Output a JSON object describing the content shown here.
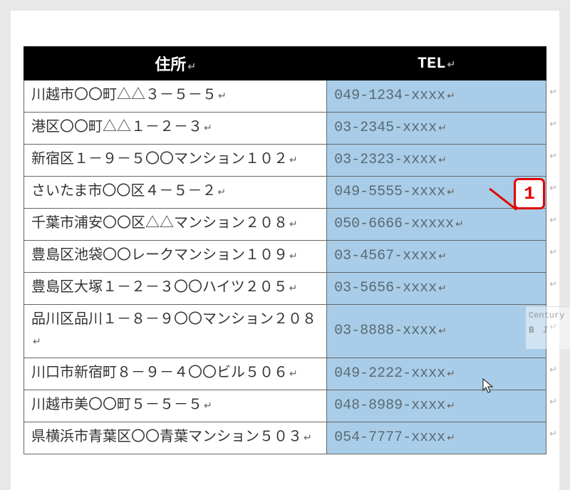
{
  "table": {
    "headers": {
      "address": "住所",
      "tel": "TEL"
    },
    "rows": [
      {
        "address": "川越市〇〇町△△３－５－５",
        "tel": "049-1234-xxxx"
      },
      {
        "address": "港区〇〇町△△１－２－３",
        "tel": "03-2345-xxxx"
      },
      {
        "address": "新宿区１－９－５〇〇マンション１０２",
        "tel": "03-2323-xxxx"
      },
      {
        "address": "さいたま市〇〇区４－５－２",
        "tel": "049-5555-xxxx"
      },
      {
        "address": "千葉市浦安〇〇区△△マンション２０８",
        "tel": "050-6666-xxxxx"
      },
      {
        "address": "豊島区池袋〇〇レークマンション１０９",
        "tel": "03-4567-xxxx"
      },
      {
        "address": "豊島区大塚１－２－３〇〇ハイツ２０５",
        "tel": "03-5656-xxxx"
      },
      {
        "address": "品川区品川１－８－９〇〇マンション２０８",
        "tel": "03-8888-xxxx"
      },
      {
        "address": "川口市新宿町８－９－４〇〇ビル５０６",
        "tel": "049-2222-xxxx"
      },
      {
        "address": "川越市美〇〇町５－５－５",
        "tel": "048-8989-xxxx"
      },
      {
        "address": "県横浜市青葉区〇〇青葉マンション５０３",
        "tel": "054-7777-xxxx"
      }
    ]
  },
  "callout": {
    "number": "1"
  },
  "pmark": "↵",
  "mini_toolbar": {
    "font": "Century",
    "bold": "B",
    "italic": "I"
  }
}
